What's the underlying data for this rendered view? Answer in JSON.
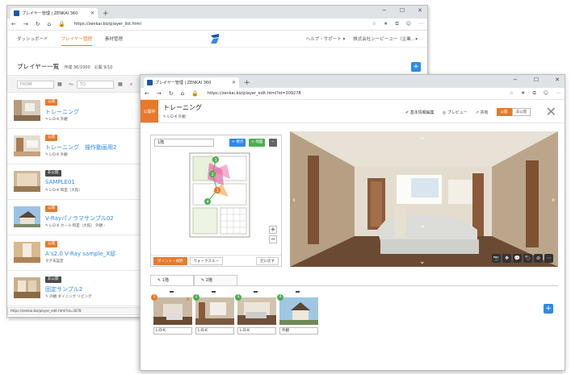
{
  "back": {
    "tab_title": "プレイヤー管理 | ZENKAI 360",
    "url": "https://zenkai.biz/player_list.html",
    "nav": [
      "ダッシュボード",
      "プレイヤー管理",
      "素材管理"
    ],
    "header_right": [
      "ヘルプ・サポート ▾",
      "株式会社シーピーユー（企業…▾"
    ],
    "list_title": "プレイヤー一覧",
    "list_count": "作成 36/1000　公開 9/10",
    "date_from_placeholder": "FROM",
    "date_to_placeholder": "TO",
    "items": [
      {
        "badge": "公開",
        "title": "トレーニング",
        "tags": "✎ L-D-K 外観"
      },
      {
        "badge": "公開",
        "title": "トレーニング　操作動画用2",
        "tags": "✎ L-D-K 外観"
      },
      {
        "badge": "非公開",
        "title": "SAMPLE01",
        "tags": "✎ L-D-K 和室（大館）"
      },
      {
        "badge": "公開",
        "title": "V-Rayパノラマサンプル02",
        "tags": "✎ L-D-K ホール 和室（大館） 外観 ･"
      },
      {
        "badge": "公開",
        "title": "A’s2.0 V-Ray sample_X邸",
        "tags": "タグ未設定"
      },
      {
        "badge": "非公開",
        "title": "固定サンプル2",
        "tags": "✎ 外観 ダイニング リビング"
      }
    ],
    "status_url": "https://zenkai.biz/player_edit.html?id=3078"
  },
  "front": {
    "tab_title": "プレイヤー管理 | ZENKAI 360",
    "url": "https://zenkai.biz/player_edit.html?id=309278",
    "pub_label": "公開中",
    "title": "トレーニング",
    "subtitle": "✎ L-D-K 外観",
    "actions": [
      "✐ 基本情報編集",
      "◎ プレビュー",
      "↗ 共有"
    ],
    "toggle_on": "公開",
    "toggle_off": "非公開",
    "floor_select": "1階",
    "btn_add_point": "+ 視点",
    "btn_add_floor": "+ 地図",
    "btn_minus": "−",
    "zoom_in": "+",
    "zoom_out": "−",
    "plan_tabs": [
      "ポイント・視野",
      "ウォークスルー"
    ],
    "plan_reset": "元に戻す",
    "pano_tools": [
      "📷",
      "✥",
      "💬",
      "🏷",
      "⊘",
      "⋯"
    ],
    "floor_tabs": [
      "✎ 1階",
      "✎ 2階"
    ],
    "scenes": [
      {
        "num": "1",
        "label": "L-D-K"
      },
      {
        "num": "2",
        "label": "L-D-K"
      },
      {
        "num": "3",
        "label": "L-D-K"
      },
      {
        "num": "4",
        "label": "外観"
      }
    ],
    "add_scene": "+"
  },
  "colors": {
    "accent": "#e8792b",
    "link": "#2d8ae8",
    "green": "#4caf50"
  }
}
